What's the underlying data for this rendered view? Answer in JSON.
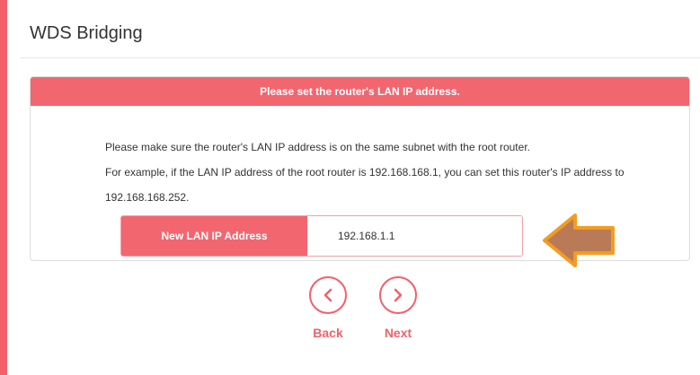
{
  "page": {
    "title": "WDS Bridging"
  },
  "card": {
    "header": "Please set the router's LAN IP address.",
    "line1": "Please make sure the router's LAN IP address is on the same subnet with the root router.",
    "line2": "For example, if the LAN IP address of the root router is 192.168.168.1, you can set this router's IP address to 192.168.168.252."
  },
  "ip_field": {
    "label": "New LAN IP Address",
    "value": "192.168.1.1"
  },
  "nav": {
    "back_label": "Back",
    "next_label": "Next"
  },
  "colors": {
    "accent": "#f2606a",
    "header_bg": "#f26670",
    "arrow_fill": "#b97a57",
    "arrow_stroke": "#f39c1f"
  },
  "icons": {
    "back": "chevron-left-icon",
    "next": "chevron-right-icon",
    "pointer": "arrow-left-icon"
  }
}
